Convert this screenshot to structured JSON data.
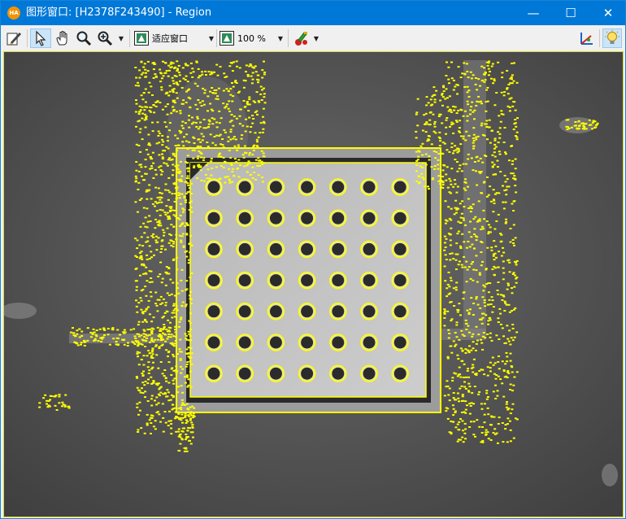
{
  "window": {
    "title": "图形窗口: [H2378F243490] - Region",
    "app_icon_text": "HA",
    "controls": {
      "minimize": "—",
      "maximize": "☐",
      "close": "✕"
    }
  },
  "toolbar": {
    "fit_window_label": "适应窗口",
    "zoom_value": "100 %"
  },
  "colors": {
    "titlebar": "#0078d7",
    "region_outline": "#ffff00",
    "background_gray": "#5c5c5c",
    "plate_gray": "#c8c8c8"
  },
  "icons": [
    "edit-icon",
    "pointer-icon",
    "hand-icon",
    "magnifier-icon",
    "zoom-in-icon",
    "fit-window-icon",
    "zoom-icon",
    "paint-icon",
    "axes-icon",
    "bulb-icon"
  ]
}
